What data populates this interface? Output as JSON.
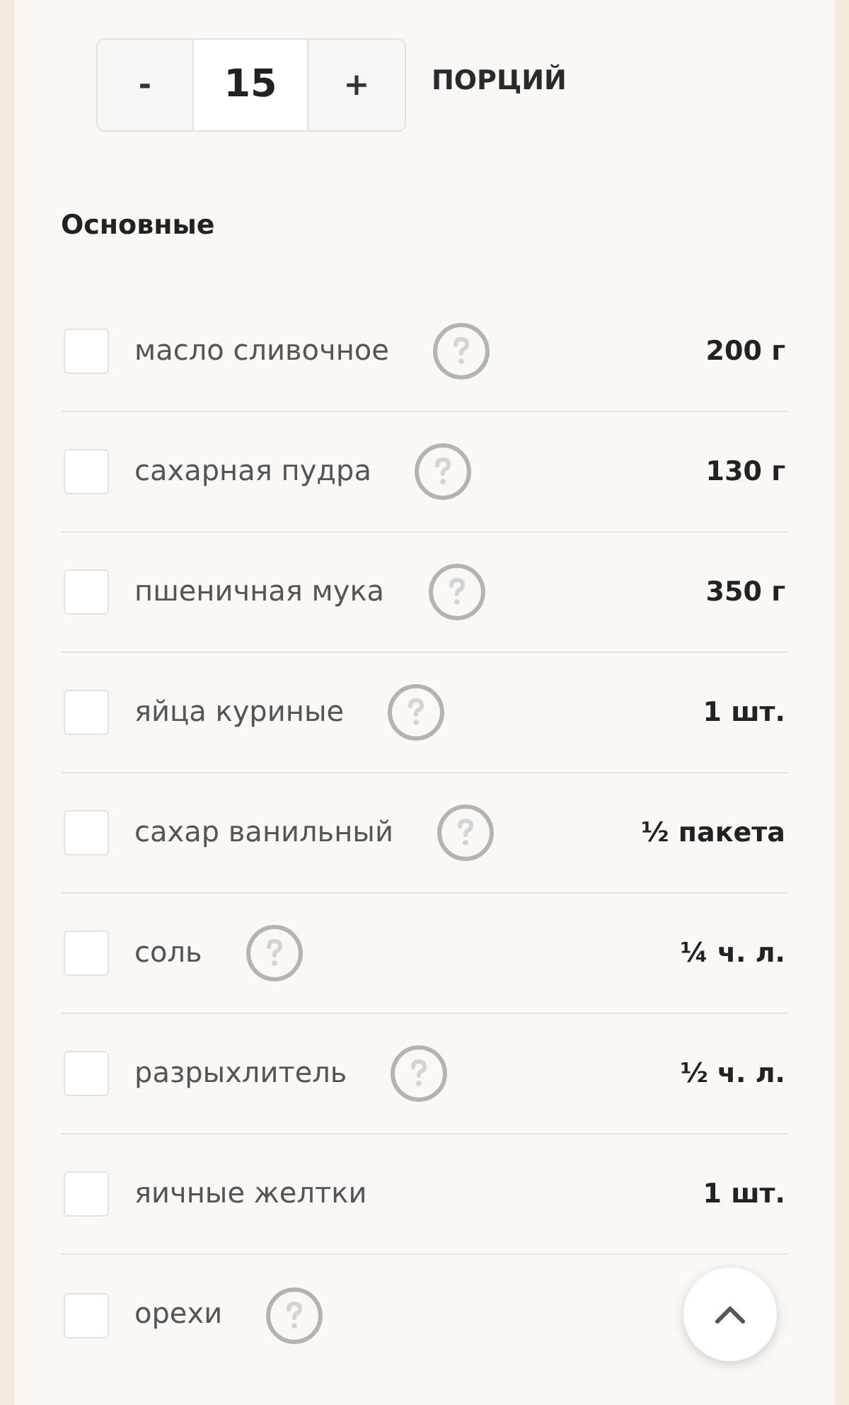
{
  "servings": {
    "decrement": "-",
    "value": "15",
    "increment": "+",
    "label": "ПОРЦИЙ"
  },
  "section": {
    "title": "Основные"
  },
  "ingredients": [
    {
      "name": "масло сливочное",
      "checked": false,
      "info": true,
      "amount": "200 г"
    },
    {
      "name": "сахарная пудра",
      "checked": false,
      "info": true,
      "amount": "130 г"
    },
    {
      "name": "пшеничная мука",
      "checked": false,
      "info": true,
      "amount": "350 г"
    },
    {
      "name": "яйца куриные",
      "checked": false,
      "info": true,
      "amount": "1 шт."
    },
    {
      "name": "сахар ванильный",
      "checked": false,
      "info": true,
      "amount": "½ пакета"
    },
    {
      "name": "соль",
      "checked": false,
      "info": true,
      "amount": "¼ ч. л."
    },
    {
      "name": "разрыхлитель",
      "checked": false,
      "info": true,
      "amount": "½ ч. л."
    },
    {
      "name": "яичные желтки",
      "checked": false,
      "info": false,
      "amount": "1 шт."
    },
    {
      "name": "орехи",
      "checked": false,
      "info": true
    }
  ]
}
